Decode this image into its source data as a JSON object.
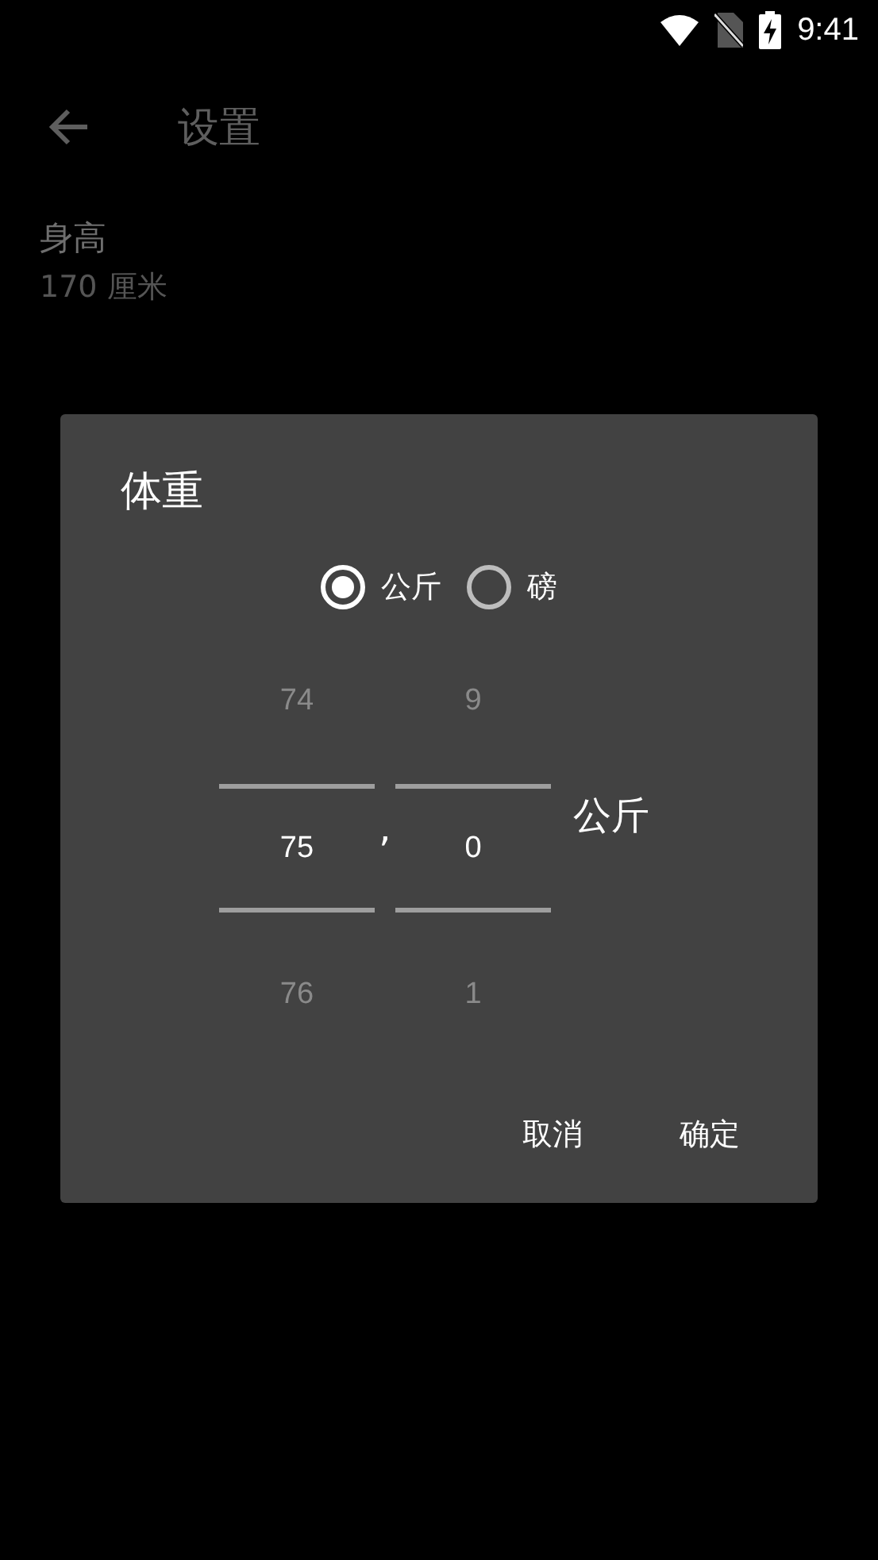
{
  "status_bar": {
    "time": "9:41"
  },
  "toolbar": {
    "title": "设置"
  },
  "settings": [
    {
      "title": "身高",
      "summary": "170 厘米"
    }
  ],
  "dialog": {
    "title": "体重",
    "units": [
      {
        "label": "公斤",
        "selected": true
      },
      {
        "label": "磅",
        "selected": false
      }
    ],
    "pickers": [
      {
        "above": "74",
        "value": "75",
        "below": "76"
      },
      {
        "above": "9",
        "value": "0",
        "below": "1"
      }
    ],
    "separator": ",",
    "unit": "公斤",
    "buttons": [
      "取消",
      "确定"
    ]
  }
}
